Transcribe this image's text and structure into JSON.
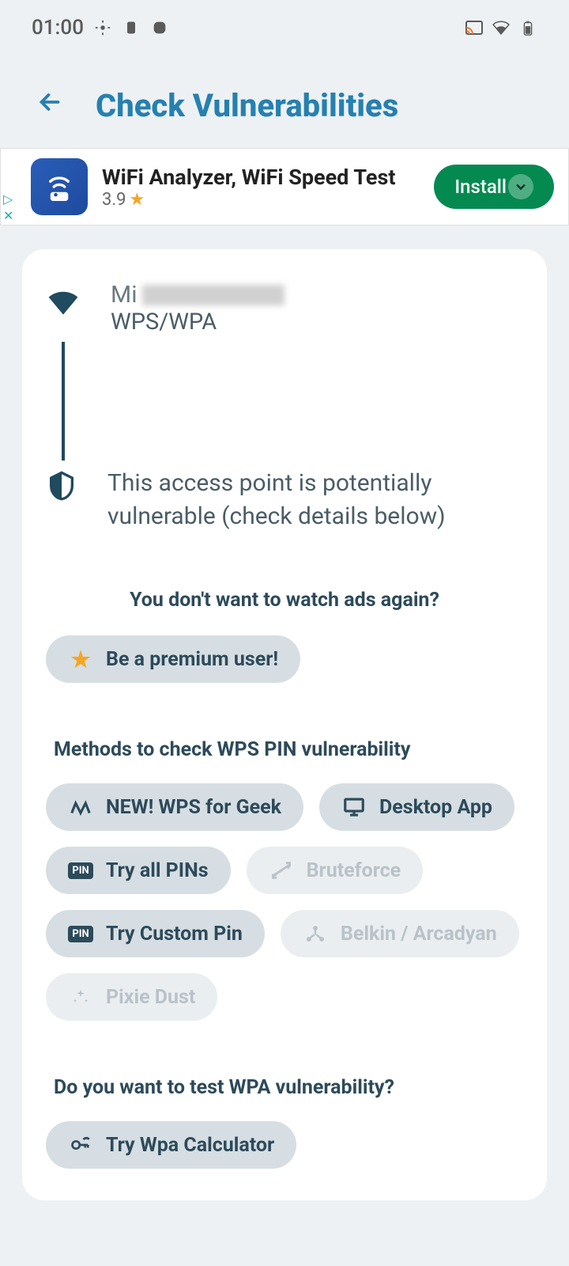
{
  "status": {
    "time": "01:00"
  },
  "header": {
    "title": "Check Vulnerabilities"
  },
  "ad": {
    "title": "WiFi Analyzer, WiFi Speed Test",
    "rating": "3.9",
    "install_label": "Install"
  },
  "network": {
    "name_prefix": "Mi",
    "security": "WPS/WPA"
  },
  "vulnerability": {
    "message": "This access point is potentially vulnerable (check details below)"
  },
  "premium": {
    "prompt": "You don't want to watch ads again?",
    "button_label": "Be a premium user!"
  },
  "wps": {
    "title": "Methods to check WPS PIN vulnerability",
    "buttons": {
      "wps_geek": "NEW! WPS for Geek",
      "desktop": "Desktop App",
      "try_pins": "Try all PINs",
      "bruteforce": "Bruteforce",
      "custom_pin": "Try Custom Pin",
      "belkin": "Belkin / Arcadyan",
      "pixie": "Pixie Dust"
    }
  },
  "wpa": {
    "title": "Do you want to test WPA vulnerability?",
    "button_label": "Try Wpa Calculator"
  }
}
